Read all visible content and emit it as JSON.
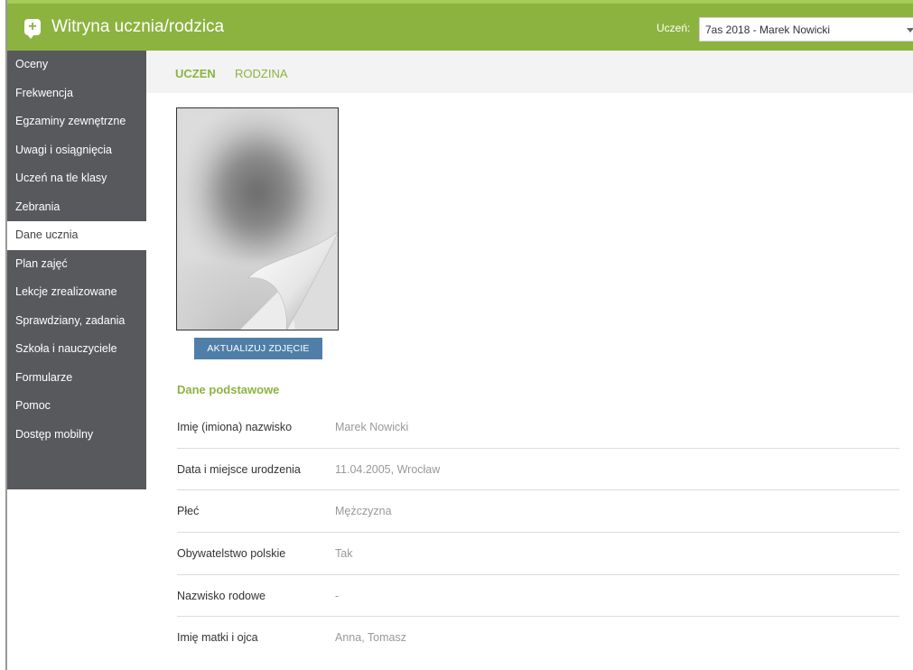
{
  "header": {
    "app_icon": "chat-plus-icon",
    "title": "Witryna ucznia/rodzica",
    "student_label": "Uczeń:",
    "student_selected": "7as 2018 - Marek Nowicki",
    "accent": "#8cb33f"
  },
  "sidebar": {
    "items": [
      {
        "label": "Oceny",
        "active": false
      },
      {
        "label": "Frekwencja",
        "active": false
      },
      {
        "label": "Egzaminy zewnętrzne",
        "active": false
      },
      {
        "label": "Uwagi i osiągnięcia",
        "active": false
      },
      {
        "label": "Uczeń na tle klasy",
        "active": false
      },
      {
        "label": "Zebrania",
        "active": false
      },
      {
        "label": "Dane ucznia",
        "active": true
      },
      {
        "label": "Plan zajęć",
        "active": false
      },
      {
        "label": "Lekcje zrealizowane",
        "active": false
      },
      {
        "label": "Sprawdziany, zadania",
        "active": false
      },
      {
        "label": "Szkoła i nauczyciele",
        "active": false
      },
      {
        "label": "Formularze",
        "active": false
      },
      {
        "label": "Pomoc",
        "active": false
      },
      {
        "label": "Dostęp mobilny",
        "active": false
      }
    ]
  },
  "tabs": {
    "uczen": "UCZEN",
    "rodzina": "RODZINA",
    "active": "uczen"
  },
  "photo": {
    "update_label": "AKTUALIZUJ ZDJĘCIE"
  },
  "basic_data": {
    "title": "Dane podstawowe",
    "rows": [
      {
        "label": "Imię (imiona) nazwisko",
        "value": "Marek Nowicki"
      },
      {
        "label": "Data i miejsce urodzenia",
        "value": "11.04.2005, Wrocław"
      },
      {
        "label": "Płeć",
        "value": "Mężczyzna"
      },
      {
        "label": "Obywatelstwo polskie",
        "value": "Tak"
      },
      {
        "label": "Nazwisko rodowe",
        "value": "-"
      },
      {
        "label": "Imię matki i ojca",
        "value": "Anna, Tomasz"
      }
    ]
  }
}
